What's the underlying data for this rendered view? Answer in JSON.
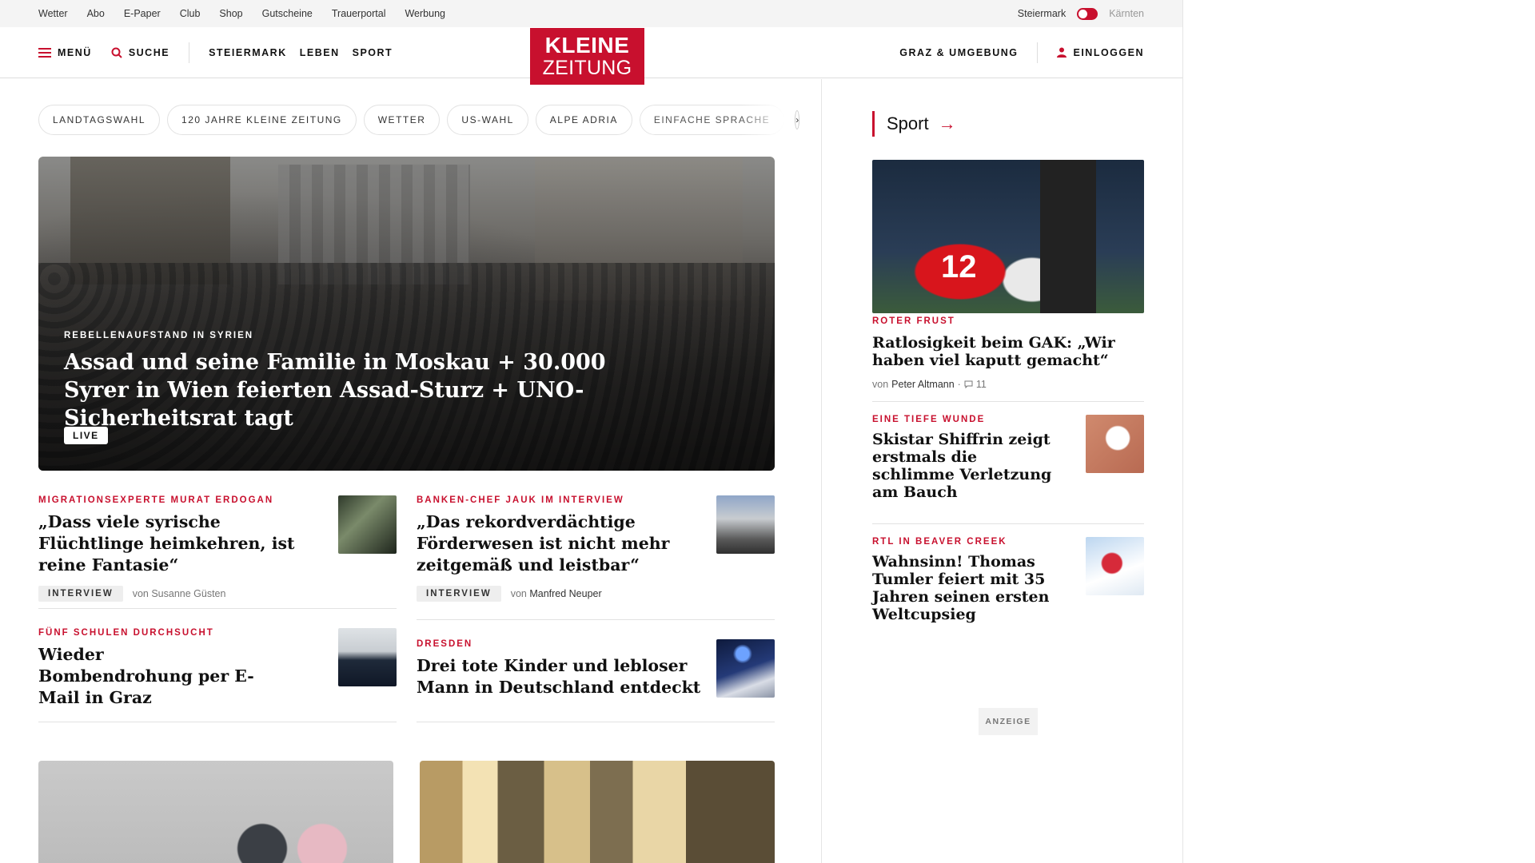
{
  "topbar": {
    "links": [
      "Wetter",
      "Abo",
      "E-Paper",
      "Club",
      "Shop",
      "Gutscheine",
      "Trauerportal",
      "Werbung"
    ],
    "region_active": "Steiermark",
    "region_inactive": "Kärnten"
  },
  "header": {
    "menu_label": "MENÜ",
    "search_label": "SUCHE",
    "nav": [
      "STEIERMARK",
      "LEBEN",
      "SPORT"
    ],
    "logo_line1": "KLEINE",
    "logo_line2": "ZEITUNG",
    "region_link": "GRAZ & UMGEBUNG",
    "login_label": "EINLOGGEN"
  },
  "tags": [
    "LANDTAGSWAHL",
    "120 JAHRE KLEINE ZEITUNG",
    "WETTER",
    "US-WAHL",
    "ALPE ADRIA",
    "EINFACHE SPRACHE"
  ],
  "tags_next": "›",
  "hero": {
    "kicker": "REBELLENAUFSTAND IN SYRIEN",
    "title": "Assad und seine Familie in Moskau + 30.000 Syrer in Wien feierten Assad-Sturz + UNO-Sicherheitsrat tagt",
    "badge": "LIVE"
  },
  "articles": {
    "left": [
      {
        "kicker": "MIGRATIONSEXPERTE MURAT ERDOGAN",
        "title": "„Dass viele syrische Flüchtlinge heimkehren, ist reine Fantasie“",
        "badge": "INTERVIEW",
        "by": "von",
        "author": "Susanne Güsten"
      },
      {
        "kicker": "FÜNF SCHULEN DURCHSUCHT",
        "title": "Wieder Bombendrohung per E-Mail in Graz"
      }
    ],
    "right": [
      {
        "kicker": "BANKEN-CHEF JAUK IM INTERVIEW",
        "title": "„Das rekordverdächtige Förderwesen ist nicht mehr zeitgemäß und leistbar“",
        "badge": "INTERVIEW",
        "by": "von",
        "author": "Manfred Neuper"
      },
      {
        "kicker": "DRESDEN",
        "title": "Drei tote Kinder und lebloser Mann in Deutschland entdeckt"
      }
    ]
  },
  "sidebar": {
    "section_title": "Sport",
    "section_arrow": "→",
    "top": {
      "jersey_number": "12",
      "kicker": "ROTER FRUST",
      "title": "Ratlosigkeit beim GAK: „Wir haben viel kaputt gemacht“",
      "by": "von",
      "author": "Peter Altmann",
      "comments": "11"
    },
    "items": [
      {
        "kicker": "EINE TIEFE WUNDE",
        "title": "Skistar Shiffrin zeigt erstmals die schlimme Verletzung am Bauch"
      },
      {
        "kicker": "RTL IN BEAVER CREEK",
        "title": "Wahnsinn! Thomas Tumler feiert mit 35 Jahren seinen ersten Weltcupsieg"
      }
    ],
    "ad_label": "ANZEIGE"
  },
  "colors": {
    "brand_red": "#c8102e",
    "topbar_bg": "#f4f4f4"
  }
}
